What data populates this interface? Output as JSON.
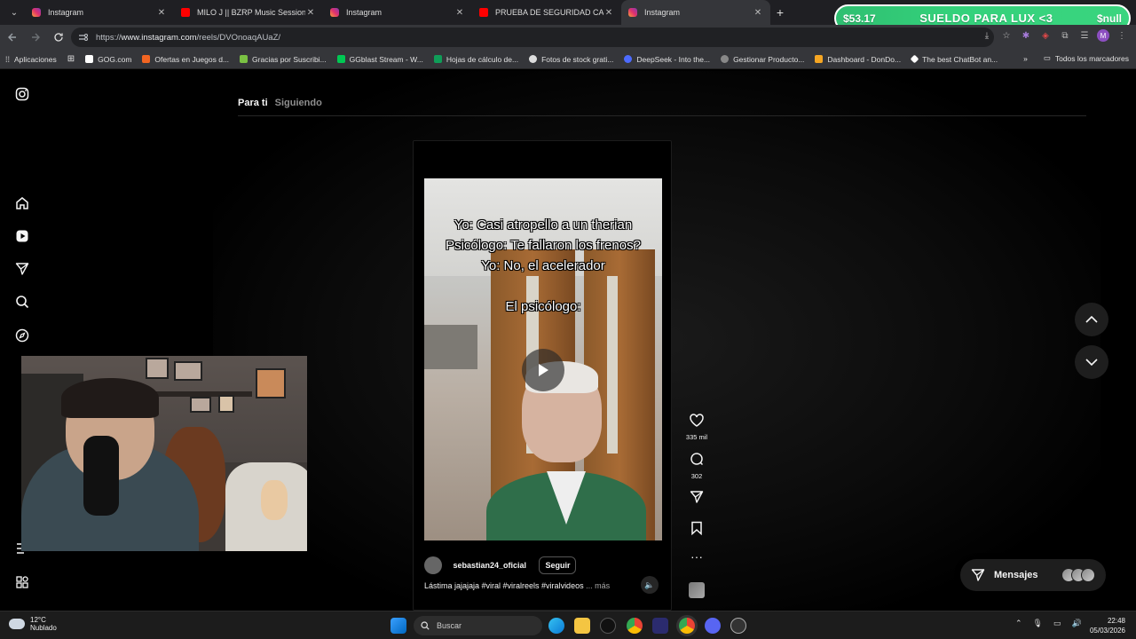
{
  "browser": {
    "tabs": [
      {
        "title": "Instagram",
        "favicon": "instagram-icon",
        "active": false
      },
      {
        "title": "MILO J || BZRP Music Sessions #",
        "favicon": "youtube-icon",
        "active": false
      },
      {
        "title": "Instagram",
        "favicon": "instagram-icon",
        "active": false
      },
      {
        "title": "PRUEBA DE SEGURIDAD CAMP",
        "favicon": "youtube-icon",
        "active": false
      },
      {
        "title": "Instagram",
        "favicon": "instagram-icon",
        "active": true
      }
    ],
    "url_prefix": "https://",
    "url_host": "www.instagram.com",
    "url_path": "/reels/DVOnoaqAUaZ/",
    "profile_initial": "M",
    "bookmarks": [
      {
        "label": "Aplicaciones",
        "color": "#e0e0e0"
      },
      {
        "label": "",
        "color": "#e0e0e0"
      },
      {
        "label": "GOG.com",
        "color": "#ffffff"
      },
      {
        "label": "Ofertas en Juegos d...",
        "color": "#f26522"
      },
      {
        "label": "Gracias por Suscribi...",
        "color": "#7ac143"
      },
      {
        "label": "GGblast Stream - W...",
        "color": "#00c853"
      },
      {
        "label": "Hojas de cálculo de...",
        "color": "#0f9d58"
      },
      {
        "label": "Fotos de stock grati...",
        "color": "#ffffff"
      },
      {
        "label": "DeepSeek - Into the...",
        "color": "#4d6bfe"
      },
      {
        "label": "Gestionar Producto...",
        "color": "#999999"
      },
      {
        "label": "Dashboard - DonDo...",
        "color": "#f5a623"
      },
      {
        "label": "The best ChatBot an...",
        "color": "#ffffff"
      }
    ],
    "all_bookmarks": "Todos los marcadores"
  },
  "overlay": {
    "amount": "$53.17",
    "message": "SUELDO PARA LUX <3",
    "name": "$null"
  },
  "instagram": {
    "feed_tabs": [
      "Para ti",
      "Siguiendo"
    ],
    "reel": {
      "caption_lines": [
        "Yo: Casi atropello a un therian",
        "Psicólogo: Te fallaron los frenos?",
        "Yo: No, el acelerador"
      ],
      "caption_bottom": "El psicólogo:",
      "author": "sebastian24_oficial",
      "follow_label": "Seguir",
      "description": "Lástima jajajaja #viral #viralreels #viralvideos",
      "description_more": "... más",
      "likes": "335 mil",
      "comments": "302"
    },
    "messages_label": "Mensajes"
  },
  "taskbar": {
    "temperature": "12°C",
    "weather": "Nublado",
    "search_placeholder": "Buscar",
    "time": "22:48",
    "date": "05/03/2026"
  }
}
